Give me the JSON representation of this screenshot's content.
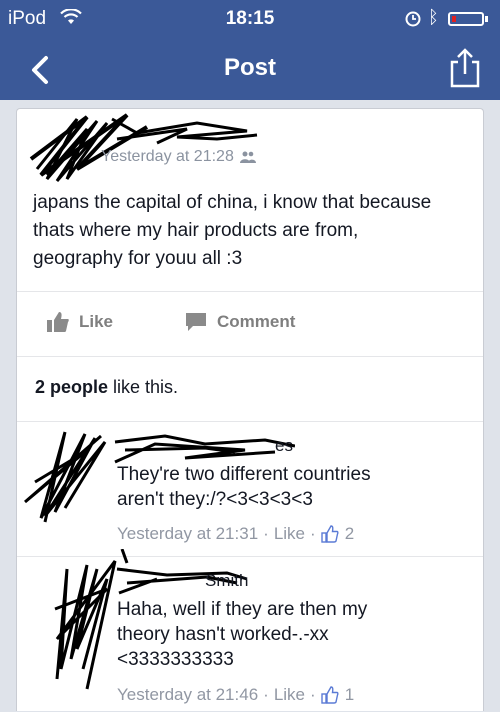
{
  "status_bar": {
    "carrier": "iPod",
    "time": "18:15",
    "battery_color": "#e02020"
  },
  "nav": {
    "title": "Post",
    "back_icon": "chevron-left-icon",
    "share_icon": "share-icon"
  },
  "post": {
    "author": "",
    "timestamp": "Yesterday at 21:28",
    "audience_icon": "friends-icon",
    "text": "japans the capital of china, i know that because thats where my hair products are from, geography for youu all :3",
    "like_label": "Like",
    "comment_label": "Comment",
    "likes_count": "2 people",
    "likes_suffix": " like this."
  },
  "comments": [
    {
      "author": "es",
      "text_line1": "They're two different countries",
      "text_line2": "aren't they:/?<3<3<3<3",
      "timestamp": "Yesterday at 21:31",
      "like_label": "Like",
      "like_count": "2"
    },
    {
      "author": "Smith",
      "text_line1": "Haha, well if they are then my",
      "text_line2": "theory hasn't worked-.-xx",
      "text_line3": "<3333333333",
      "timestamp": "Yesterday at 21:46",
      "like_label": "Like",
      "like_count": "1"
    }
  ],
  "colors": {
    "brand": "#3b5998",
    "meta_text": "#9197a3",
    "action_text": "#7f7f7f"
  }
}
